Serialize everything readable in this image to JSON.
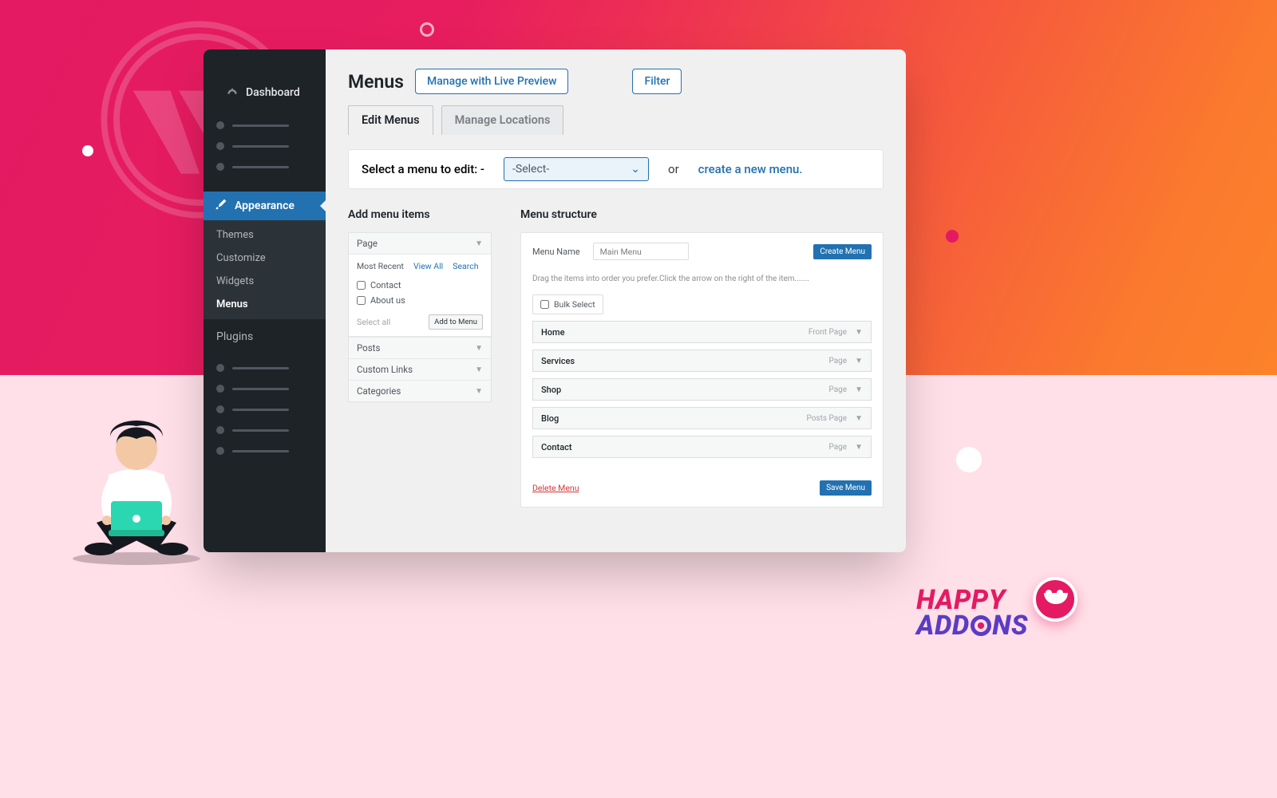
{
  "sidebar": {
    "dashboard": "Dashboard",
    "appearance": "Appearance",
    "sub": {
      "themes": "Themes",
      "customize": "Customize",
      "widgets": "Widgets",
      "menus": "Menus"
    },
    "plugins": "Plugins"
  },
  "header": {
    "title": "Menus",
    "live_preview": "Manage with Live Preview",
    "filter": "Filter",
    "tabs": {
      "edit": "Edit Menus",
      "manage": "Manage Locations"
    }
  },
  "selectbar": {
    "label": "Select a menu to edit: -",
    "value": "-Select-",
    "or": "or",
    "create": "create a new menu."
  },
  "add_panel": {
    "title": "Add menu items",
    "groups": {
      "page": "Page",
      "posts": "Posts",
      "custom": "Custom Links",
      "categories": "Categories"
    },
    "mini_tabs": {
      "recent": "Most Recent",
      "view_all": "View All",
      "search": "Search"
    },
    "items": {
      "contact": "Contact",
      "about": "About us"
    },
    "select_all": "Select all",
    "add_btn": "Add to Menu"
  },
  "structure": {
    "title": "Menu structure",
    "name_label": "Menu Name",
    "name_value": "Main Menu",
    "create_btn": "Create Menu",
    "hint": "Drag the items into order  you prefer.Click the arrow on the right of the item.......",
    "bulk": "Bulk Select",
    "items": [
      {
        "label": "Home",
        "type": "Front Page"
      },
      {
        "label": "Services",
        "type": "Page"
      },
      {
        "label": "Shop",
        "type": "Page"
      },
      {
        "label": "Blog",
        "type": "Posts Page"
      },
      {
        "label": "Contact",
        "type": "Page"
      }
    ],
    "delete": "Delete Menu",
    "save": "Save Menu"
  },
  "brand": {
    "line1": "HAPPY",
    "line2a": "ADD",
    "line2b": "NS"
  }
}
